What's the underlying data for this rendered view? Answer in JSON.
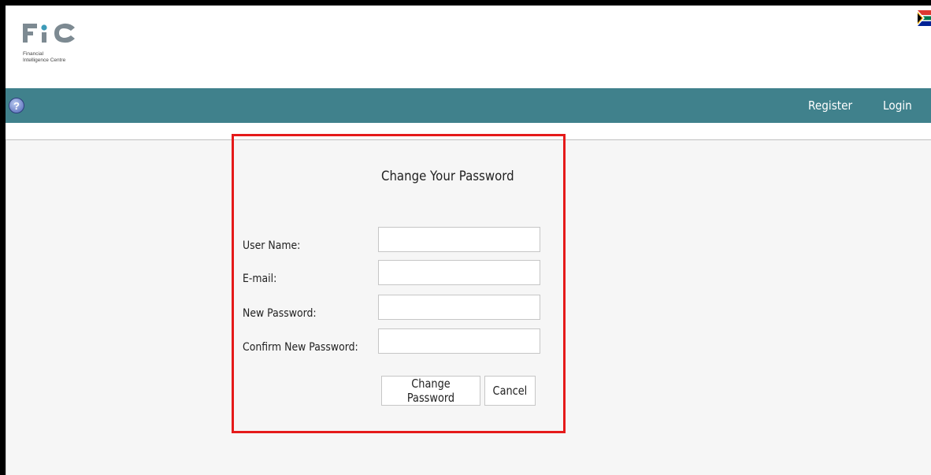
{
  "header": {
    "logo_text": "FIC",
    "logo_sub_line1": "Financial",
    "logo_sub_line2": "Intelligence Centre"
  },
  "navbar": {
    "help_icon": "?",
    "links": {
      "register": "Register",
      "login": "Login"
    },
    "color": "#40818c"
  },
  "form": {
    "title": "Change Your Password",
    "fields": {
      "username": {
        "label": "User Name:",
        "value": ""
      },
      "email": {
        "label": "E-mail:",
        "value": ""
      },
      "new_password": {
        "label": "New Password:",
        "value": ""
      },
      "confirm_password": {
        "label": "Confirm New Password:",
        "value": ""
      }
    },
    "buttons": {
      "change": "Change Password",
      "cancel": "Cancel"
    }
  },
  "colors": {
    "highlight_border": "#e51a1a",
    "content_bg": "#f6f6f6"
  },
  "icons": {
    "help": "help-icon",
    "flag": "south-africa-flag-icon"
  }
}
